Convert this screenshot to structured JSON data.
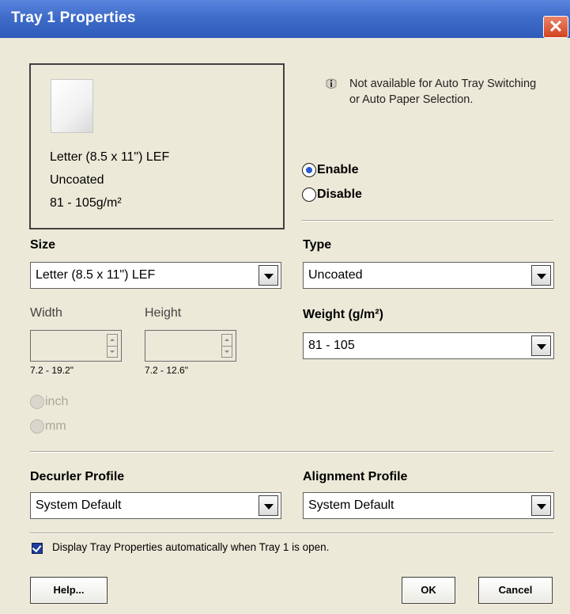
{
  "window": {
    "title": "Tray 1 Properties",
    "close_glyph": "✕"
  },
  "preview": {
    "icon": "paper-sheet-icon",
    "size_text": "Letter (8.5 x 11\") LEF",
    "type_text": "Uncoated",
    "weight_text": "81 - 105g/m²"
  },
  "info": {
    "icon": "info-icon",
    "text": "Not available for Auto Tray Switching or Auto Paper Selection."
  },
  "mode": {
    "enable_label": "Enable",
    "disable_label": "Disable",
    "selected": "Enable"
  },
  "size": {
    "label": "Size",
    "value": "Letter (8.5 x 11\") LEF",
    "width_label": "Width",
    "width_value": "",
    "width_range": "7.2 - 19.2\"",
    "height_label": "Height",
    "height_value": "",
    "height_range": "7.2 - 12.6\"",
    "unit_inch": "inch",
    "unit_mm": "mm"
  },
  "type": {
    "label": "Type",
    "value": "Uncoated"
  },
  "weight": {
    "label": "Weight (g/m²)",
    "value": "81 - 105"
  },
  "decurler": {
    "label": "Decurler Profile",
    "value": "System Default"
  },
  "alignment": {
    "label": "Alignment Profile",
    "value": "System Default"
  },
  "auto_display": {
    "checked": true,
    "label": "Display Tray Properties automatically when Tray 1 is open."
  },
  "buttons": {
    "help": "Help...",
    "ok": "OK",
    "cancel": "Cancel"
  },
  "colors": {
    "titlebar": "#3f6cc9",
    "background": "#ece9d8",
    "radio_selected": "#2a5bd0",
    "close": "#d2431f"
  }
}
